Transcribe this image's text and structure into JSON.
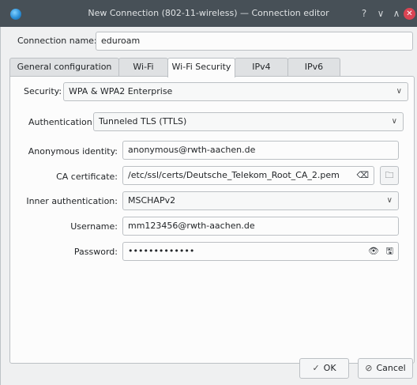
{
  "window": {
    "title": "New Connection (802-11-wireless) — Connection editor",
    "help_glyph": "?",
    "minimize_glyph": "∨",
    "maximize_glyph": "∧",
    "close_glyph": "✕"
  },
  "connection_name": {
    "label": "Connection name:",
    "value": "eduroam"
  },
  "tabs": [
    {
      "label": "General configuration",
      "active": false
    },
    {
      "label": "Wi-Fi",
      "active": false
    },
    {
      "label": "Wi-Fi Security",
      "active": true
    },
    {
      "label": "IPv4",
      "active": false
    },
    {
      "label": "IPv6",
      "active": false
    }
  ],
  "security": {
    "label": "Security:",
    "value": "WPA & WPA2 Enterprise"
  },
  "authentication": {
    "label": "Authentication:",
    "value": "Tunneled TLS (TTLS)"
  },
  "anonymous_identity": {
    "label": "Anonymous identity:",
    "value": "anonymous@rwth-aachen.de"
  },
  "ca_certificate": {
    "label": "CA certificate:",
    "value": "/etc/ssl/certs/Deutsche_Telekom_Root_CA_2.pem"
  },
  "inner_authentication": {
    "label": "Inner authentication:",
    "value": "MSCHAPv2"
  },
  "username": {
    "label": "Username:",
    "value": "mm123456@rwth-aachen.de"
  },
  "password": {
    "label": "Password:",
    "value": "•••••••••••••"
  },
  "icons": {
    "chevron": "∨",
    "clear": "⌫",
    "folder": "🗀",
    "eye": "👁",
    "save": "🖫",
    "ok": "✓",
    "cancel": "⊘"
  },
  "footer": {
    "ok_label": "OK",
    "cancel_label": "Cancel"
  }
}
